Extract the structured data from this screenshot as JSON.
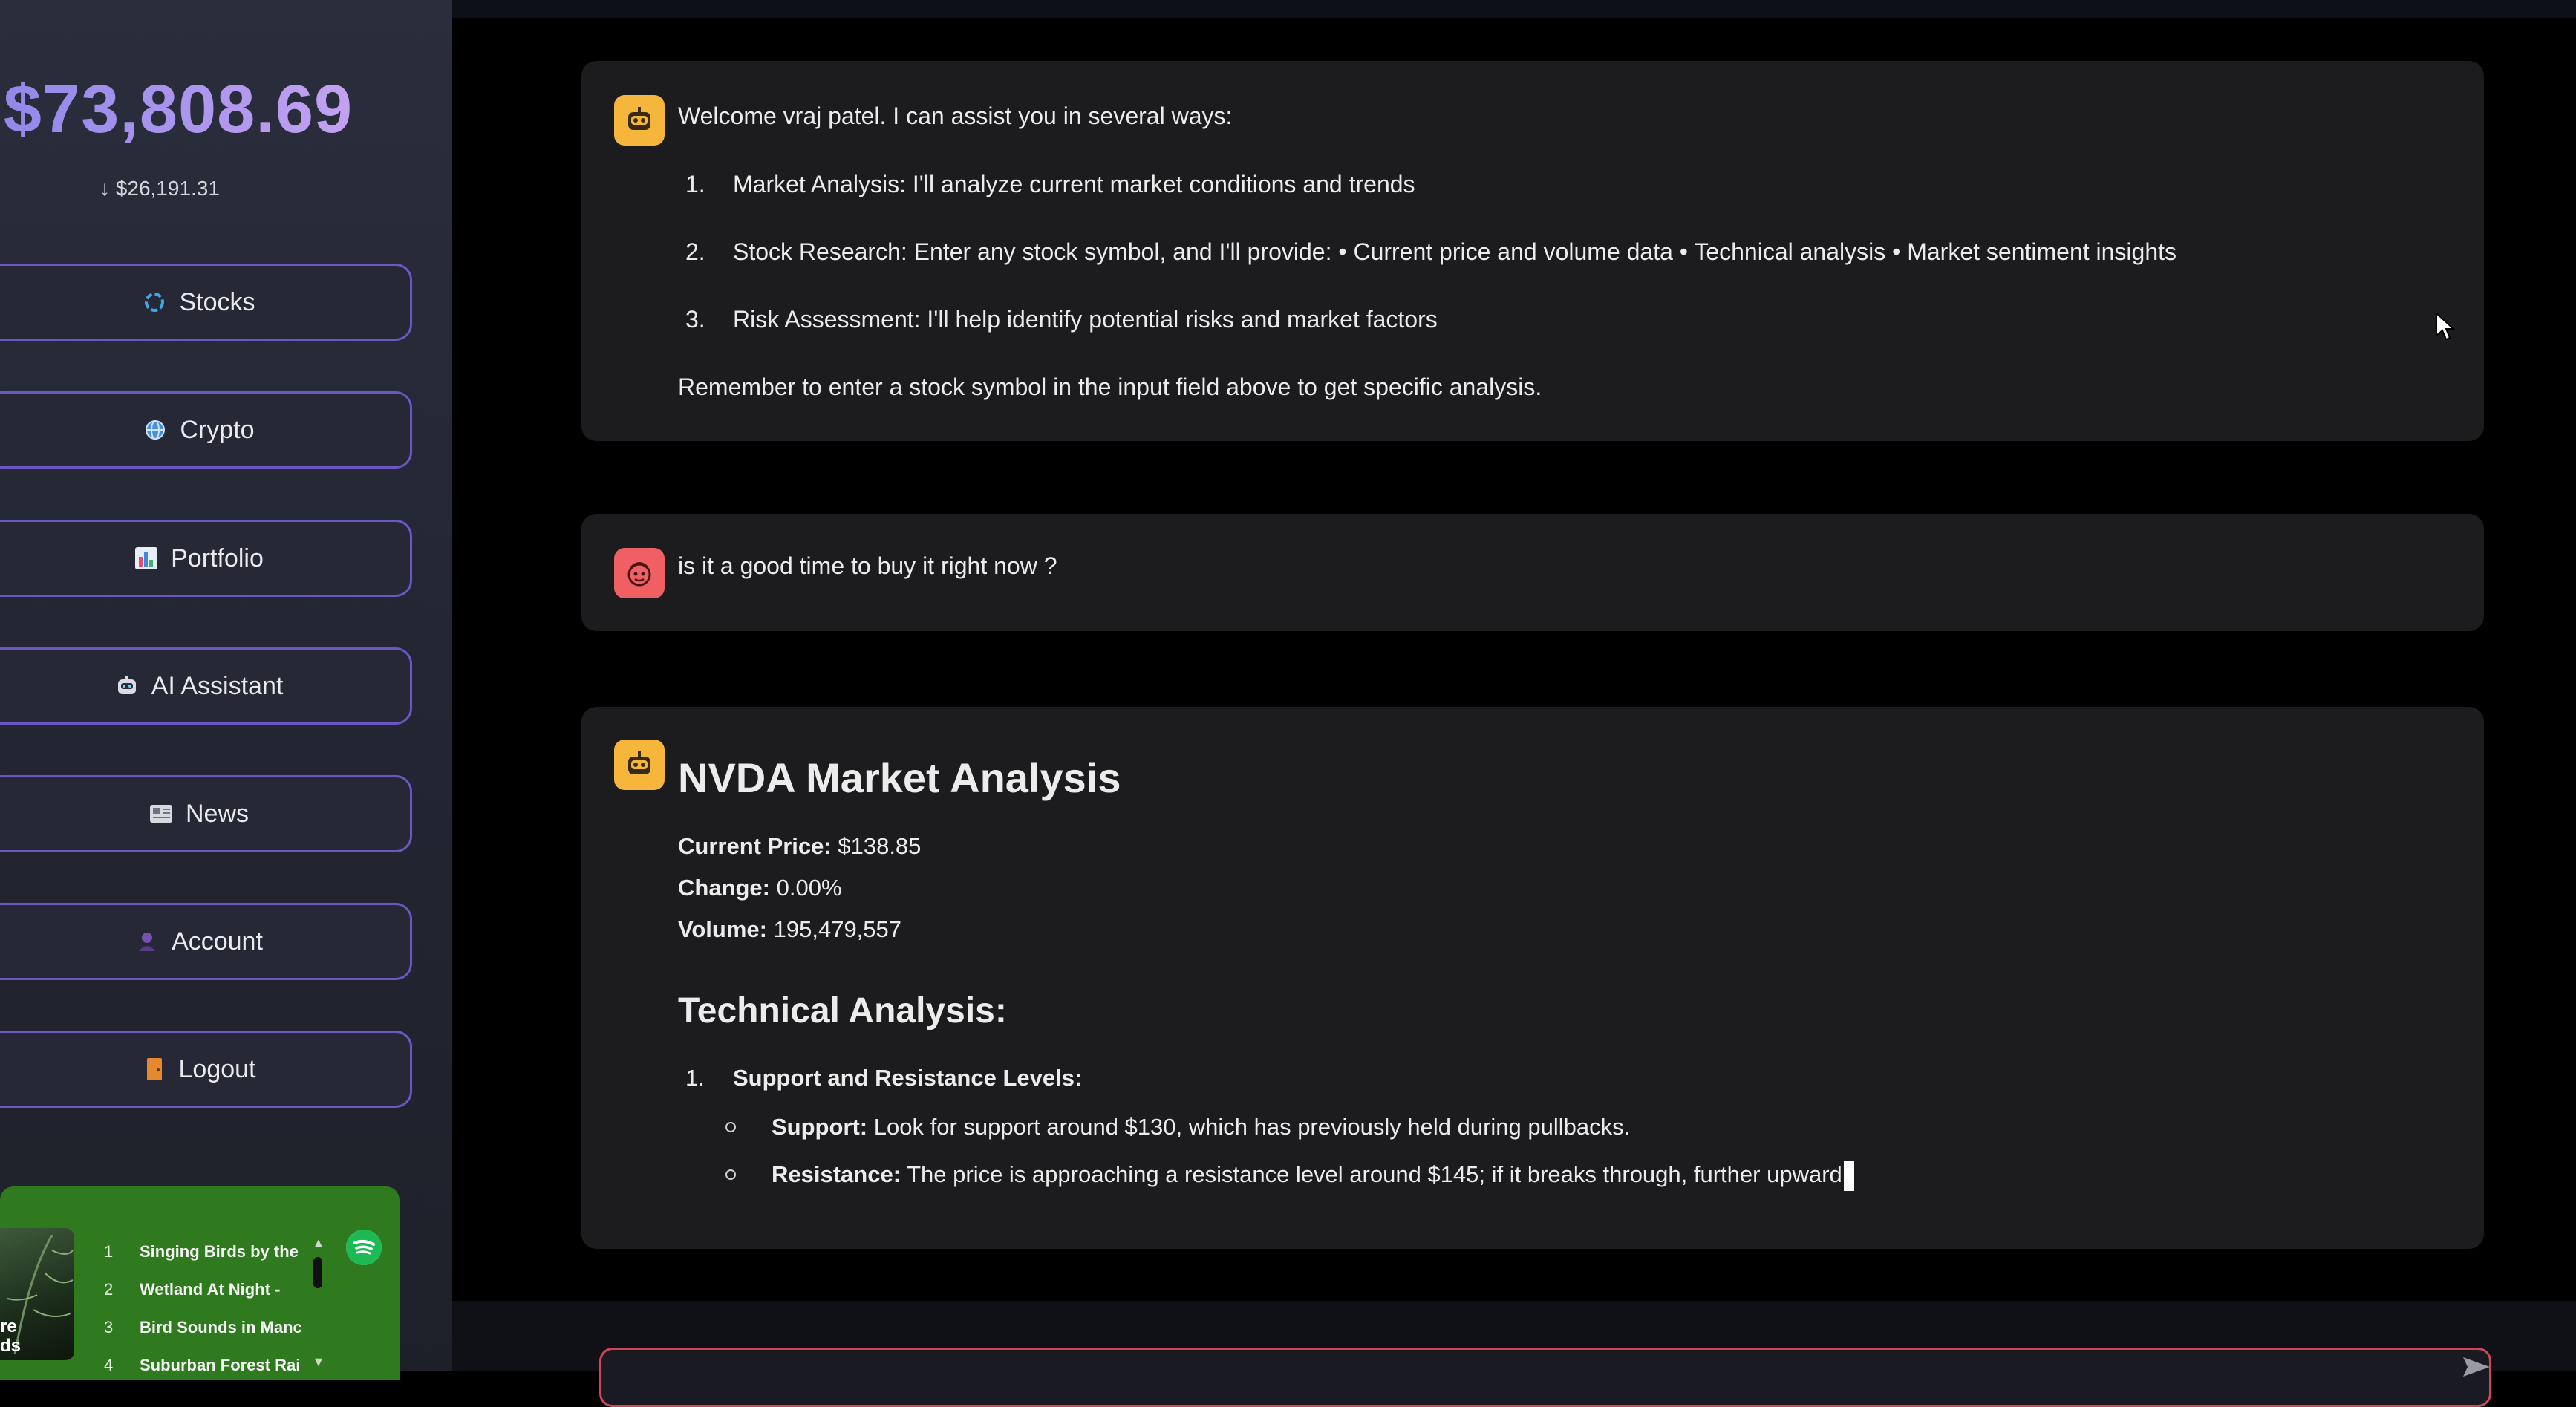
{
  "sidebar": {
    "balance": "$73,808.69",
    "balance_change": "↓ $26,191.31",
    "nav": [
      {
        "label": "Stocks",
        "icon": "loading-ring-icon"
      },
      {
        "label": "Crypto",
        "icon": "globe-icon"
      },
      {
        "label": "Portfolio",
        "icon": "bar-chart-icon"
      },
      {
        "label": "AI Assistant",
        "icon": "robot-icon"
      },
      {
        "label": "News",
        "icon": "newspaper-icon"
      },
      {
        "label": "Account",
        "icon": "person-icon"
      },
      {
        "label": "Logout",
        "icon": "door-icon"
      }
    ],
    "spotify": {
      "cover_text": "re\nds",
      "tracks": [
        {
          "num": "1",
          "title": "Singing Birds by the"
        },
        {
          "num": "2",
          "title": "Wetland At Night -"
        },
        {
          "num": "3",
          "title": "Bird Sounds in Manc"
        },
        {
          "num": "4",
          "title": "Suburban Forest Rai"
        }
      ]
    }
  },
  "chat": {
    "welcome": {
      "intro": "Welcome vraj patel. I can assist you in several ways:",
      "items": [
        {
          "num": "1.",
          "text": "Market Analysis: I'll analyze current market conditions and trends"
        },
        {
          "num": "2.",
          "text": "Stock Research: Enter any stock symbol, and I'll provide: • Current price and volume data • Technical analysis • Market sentiment insights"
        },
        {
          "num": "3.",
          "text": "Risk Assessment: I'll help identify potential risks and market factors"
        }
      ],
      "outro": "Remember to enter a stock symbol in the input field above to get specific analysis."
    },
    "user_message": "is it a good time to buy it right now ?",
    "analysis": {
      "title": "NVDA Market Analysis",
      "price_label": "Current Price:",
      "price_value": "$138.85",
      "change_label": "Change:",
      "change_value": "0.00%",
      "volume_label": "Volume:",
      "volume_value": "195,479,557",
      "technical_heading": "Technical Analysis:",
      "item_num": "1.",
      "item_title": "Support and Resistance Levels:",
      "support_label": "Support:",
      "support_text": "Look for support around $130, which has previously held during pullbacks.",
      "resistance_label": "Resistance:",
      "resistance_text": "The price is approaching a resistance level around $145; if it breaks through, further upward"
    },
    "input_placeholder": ""
  }
}
